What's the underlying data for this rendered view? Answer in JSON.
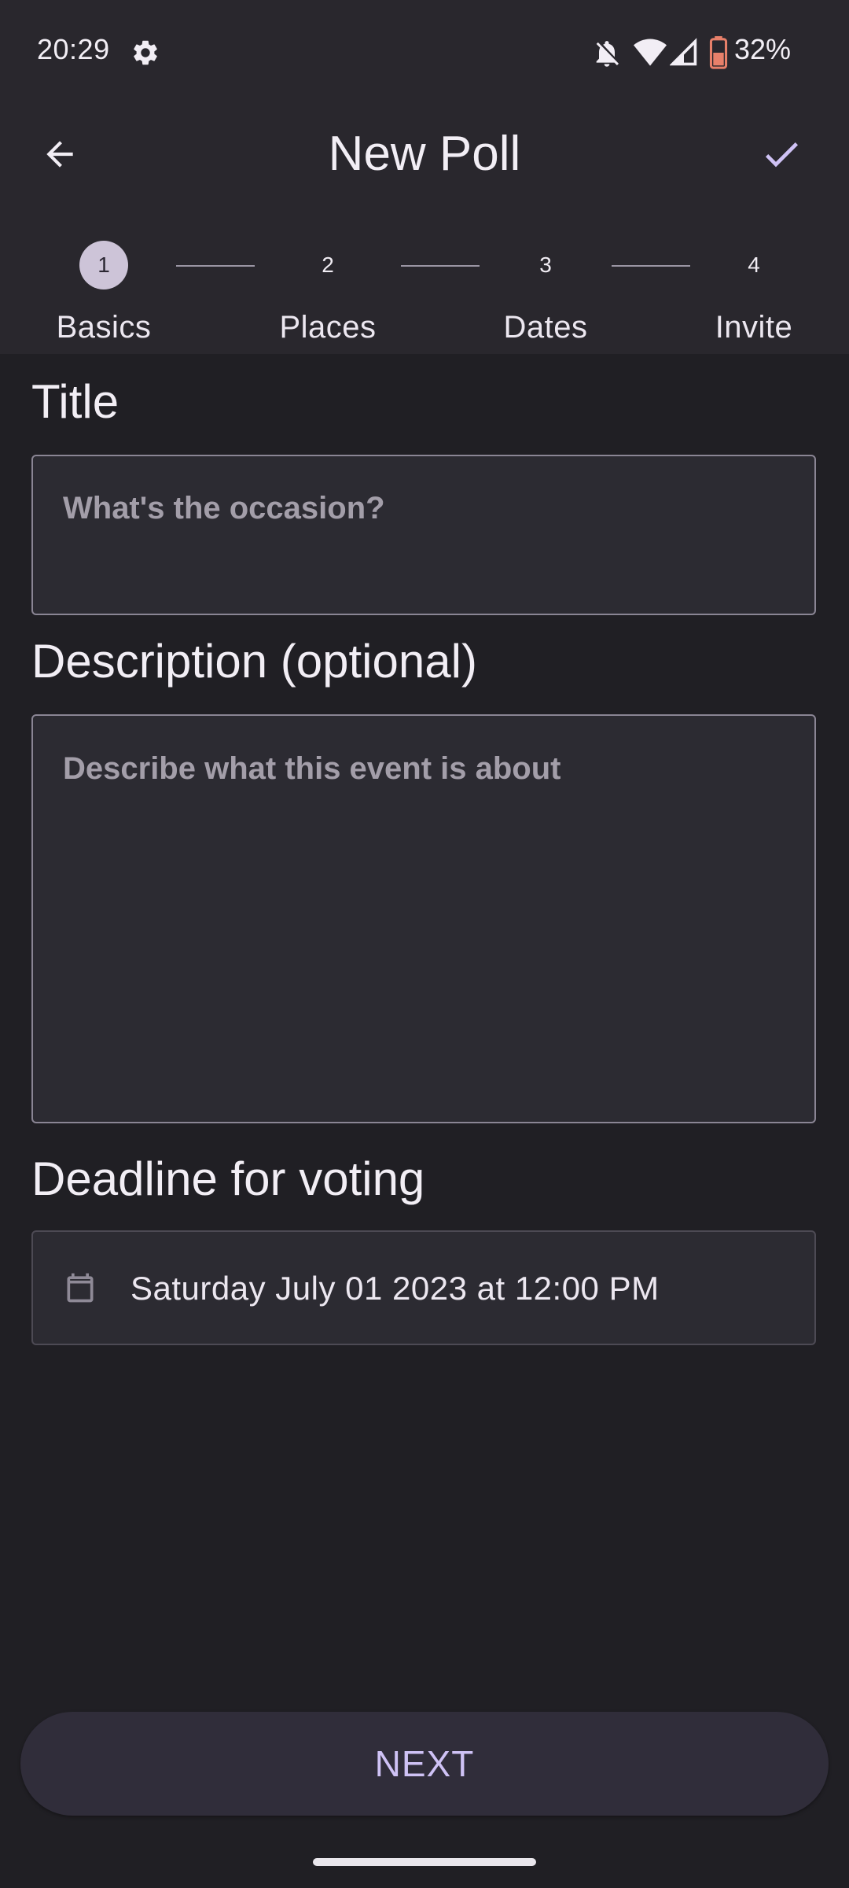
{
  "status_bar": {
    "time": "20:29",
    "battery_percent": "32%",
    "icons": [
      "settings-icon",
      "bell-off-icon",
      "wifi-icon",
      "signal-icon",
      "battery-icon"
    ]
  },
  "app_bar": {
    "title": "New Poll",
    "back_icon": "arrow-left-icon",
    "done_icon": "check-icon"
  },
  "stepper": {
    "steps": [
      {
        "number": "1",
        "label": "Basics",
        "active": true
      },
      {
        "number": "2",
        "label": "Places",
        "active": false
      },
      {
        "number": "3",
        "label": "Dates",
        "active": false
      },
      {
        "number": "4",
        "label": "Invite",
        "active": false
      }
    ]
  },
  "form": {
    "title_label": "Title",
    "title_placeholder": "What's the occasion?",
    "title_value": "",
    "description_label": "Description (optional)",
    "description_placeholder": "Describe what this event is about",
    "description_value": "",
    "deadline_label": "Deadline for voting",
    "deadline_value": "Saturday July 01 2023 at 12:00 PM",
    "deadline_icon": "calendar-icon"
  },
  "footer": {
    "next_label": "NEXT"
  },
  "colors": {
    "background": "#201f24",
    "surface": "#29272d",
    "accent": "#cfc2f5",
    "step_active": "#cdc4d8"
  }
}
